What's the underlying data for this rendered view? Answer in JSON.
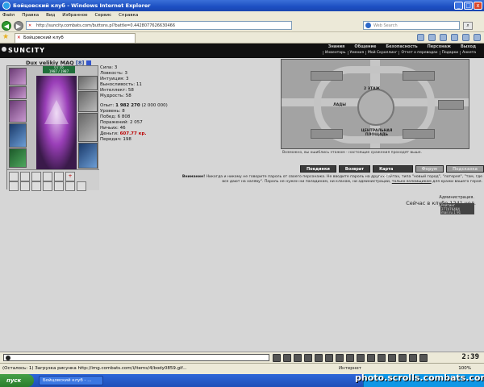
{
  "window": {
    "title": "Бойцовский клуб - Windows Internet Explorer",
    "controls": [
      "_",
      "□",
      "x"
    ]
  },
  "menu": [
    "Файл",
    "Правка",
    "Вид",
    "Избранное",
    "Сервис",
    "Справка"
  ],
  "address": {
    "url": "http://suncity.combats.com/buttons.pl?battle=0.4428077626630466"
  },
  "search": {
    "placeholder": "Web Search"
  },
  "tab": {
    "label": "Бойцовский клуб"
  },
  "site": {
    "logo": "SUNCITY",
    "topmenu": [
      "Знания",
      "Общение",
      "Безопасность",
      "Персонаж",
      "Выход"
    ],
    "submenu": [
      "Инвентарь",
      "Умения",
      "Мой Скроллинг",
      "Отчет о переводах",
      "Подарки",
      "Анкета"
    ]
  },
  "character": {
    "name": "Dux velikiy MAQ",
    "level": "[8]",
    "hp": "0 / 16",
    "mp": "1987 / 1987"
  },
  "stats": {
    "strength": "Сила: 3",
    "agility": "Ловкость: 3",
    "intuition": "Интуиция: 3",
    "endurance": "Выносливость: 11",
    "intellect": "Интеллект: 58",
    "wisdom": "Мудрость: 58",
    "exp_label": "Опыт:",
    "exp_value": "1 982 270",
    "exp_next": "(2 000 000)",
    "level": "Уровень: 8",
    "wins": "Побед: 6 808",
    "losses": "Поражений: 2 057",
    "draws": "Ничьих: 46",
    "money_label": "Деньги:",
    "money_value": "607.77 кр.",
    "transfers": "Передач: 198"
  },
  "map": {
    "floor_label": "2 ЭТАЖ",
    "hall_label": "ЛАДЫ",
    "center_label": "ЦЕНТРАЛЬНАЯ ПЛОЩАДЬ",
    "note": "Возможно, вы ошиблись этажом - настоящие сражения проходят выше."
  },
  "map_buttons": [
    "Поединки",
    "Возврат",
    "Карта клуба",
    "Форум",
    "Подсказка"
  ],
  "warning": {
    "title": "Внимание!",
    "text": "Никогда и никому не говорите пароль от своего персонажа. Не вводите пароль на других сайтах, типа \"новый город\", \"лотерея\", \"там, где все дают на халяву\". Пароль не нужен ни паладинам, ни кланам, ни администрации,",
    "link": "только взломщикам",
    "tail": "для кражи вашего героя."
  },
  "admin": "Администрация.",
  "online": "Сейчас в клубе 1241 чел.",
  "counter": {
    "line1": "Рейтинг 277476484",
    "line2": "mail.ru 1 91"
  },
  "clock": "2:39",
  "status": {
    "text": "(Осталось: 1) Загрузка рисунка http://img.combats.com/i/items/4/body0859.gif...",
    "zone": "Интернет",
    "zoom": "100%"
  },
  "taskbar": {
    "start": "пуск",
    "item": "Бойцовский клуб - ..."
  },
  "watermark": "photo.scrolls.combats.com"
}
